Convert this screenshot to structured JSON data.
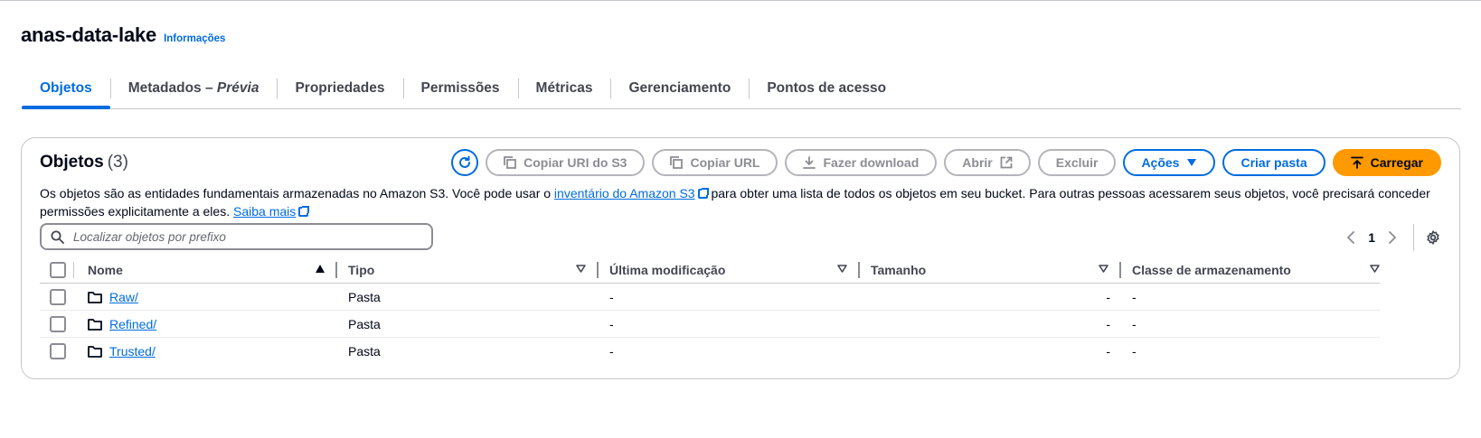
{
  "bucket": {
    "name": "anas-data-lake",
    "info_link": "Informações"
  },
  "tabs": [
    {
      "label": "Objetos",
      "active": true
    },
    {
      "label": "Metadados – ",
      "label_italic": "Prévia",
      "active": false
    },
    {
      "label": "Propriedades",
      "active": false
    },
    {
      "label": "Permissões",
      "active": false
    },
    {
      "label": "Métricas",
      "active": false
    },
    {
      "label": "Gerenciamento",
      "active": false
    },
    {
      "label": "Pontos de acesso",
      "active": false
    }
  ],
  "objects_panel": {
    "title": "Objetos",
    "count": "(3)",
    "description_part1": "Os objetos são as entidades fundamentais armazenadas no Amazon S3. Você pode usar o ",
    "inventory_link": "inventário do Amazon S3",
    "description_part2": " para obter uma lista de todos os objetos em seu bucket. Para outras pessoas acessarem seus objetos, você precisará conceder permissões explicitamente a eles. ",
    "learn_more_link": "Saiba mais"
  },
  "toolbar": {
    "refresh_icon": "refresh-icon",
    "copy_s3_uri": "Copiar URI do S3",
    "copy_url": "Copiar URL",
    "download": "Fazer download",
    "open": "Abrir",
    "delete": "Excluir",
    "actions": "Ações",
    "create_folder": "Criar pasta",
    "upload": "Carregar",
    "colors": {
      "accent": "#006ce0",
      "primary": "#ff9900",
      "disabled": "#8c8c94"
    }
  },
  "search": {
    "placeholder": "Localizar objetos por prefixo",
    "value": ""
  },
  "pagination": {
    "current_page": "1"
  },
  "table": {
    "columns": [
      "Nome",
      "Tipo",
      "Última modificação",
      "Tamanho",
      "Classe de armazenamento"
    ],
    "rows": [
      {
        "name": "Raw/",
        "type": "Pasta",
        "last_modified": "-",
        "size": "-",
        "storage_class": "-"
      },
      {
        "name": "Refined/",
        "type": "Pasta",
        "last_modified": "-",
        "size": "-",
        "storage_class": "-"
      },
      {
        "name": "Trusted/",
        "type": "Pasta",
        "last_modified": "-",
        "size": "-",
        "storage_class": "-"
      }
    ]
  }
}
